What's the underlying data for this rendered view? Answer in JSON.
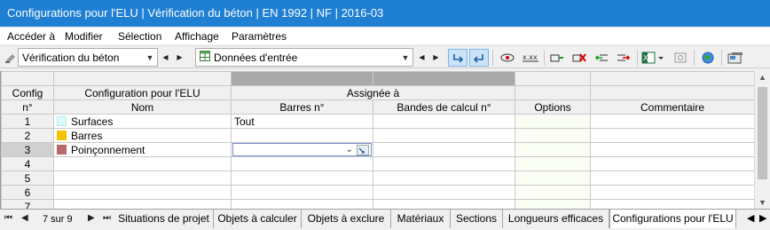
{
  "window": {
    "title": "Configurations pour l'ELU | Vérification du béton | EN 1992 | NF | 2016-03"
  },
  "menu": {
    "items": [
      "Accéder à",
      "Modifier",
      "Sélection",
      "Affichage",
      "Paramètres"
    ]
  },
  "toolbar": {
    "module_select": "Vérification du béton",
    "input_select": "Données d'entrée"
  },
  "table": {
    "header": {
      "col_a_top": "Config",
      "col_a_bottom": "n°",
      "col_b_top": "Configuration pour l'ELU",
      "col_b_bottom": "Nom",
      "group_assigned": "Assignée à",
      "col_c": "Barres n°",
      "col_d": "Bandes de calcul n°",
      "col_e": "Options",
      "col_f": "Commentaire"
    },
    "rows": [
      {
        "no": "1",
        "name": "Surfaces",
        "color": "#d9fbfb",
        "barres": "Tout"
      },
      {
        "no": "2",
        "name": "Barres",
        "color": "#f2c400",
        "barres": ""
      },
      {
        "no": "3",
        "name": "Poinçonnement",
        "color": "#b86a6a",
        "barres": ""
      },
      {
        "no": "4",
        "name": "",
        "color": "",
        "barres": ""
      },
      {
        "no": "5",
        "name": "",
        "color": "",
        "barres": ""
      },
      {
        "no": "6",
        "name": "",
        "color": "",
        "barres": ""
      },
      {
        "no": "7",
        "name": "",
        "color": "",
        "barres": ""
      }
    ]
  },
  "tabs": {
    "page_count": "7 sur 9",
    "items": [
      "Situations de projet",
      "Objets à calculer",
      "Objets à exclure",
      "Matériaux",
      "Sections",
      "Longueurs efficaces",
      "Configurations pour l'ELU"
    ],
    "active_index": 6
  }
}
